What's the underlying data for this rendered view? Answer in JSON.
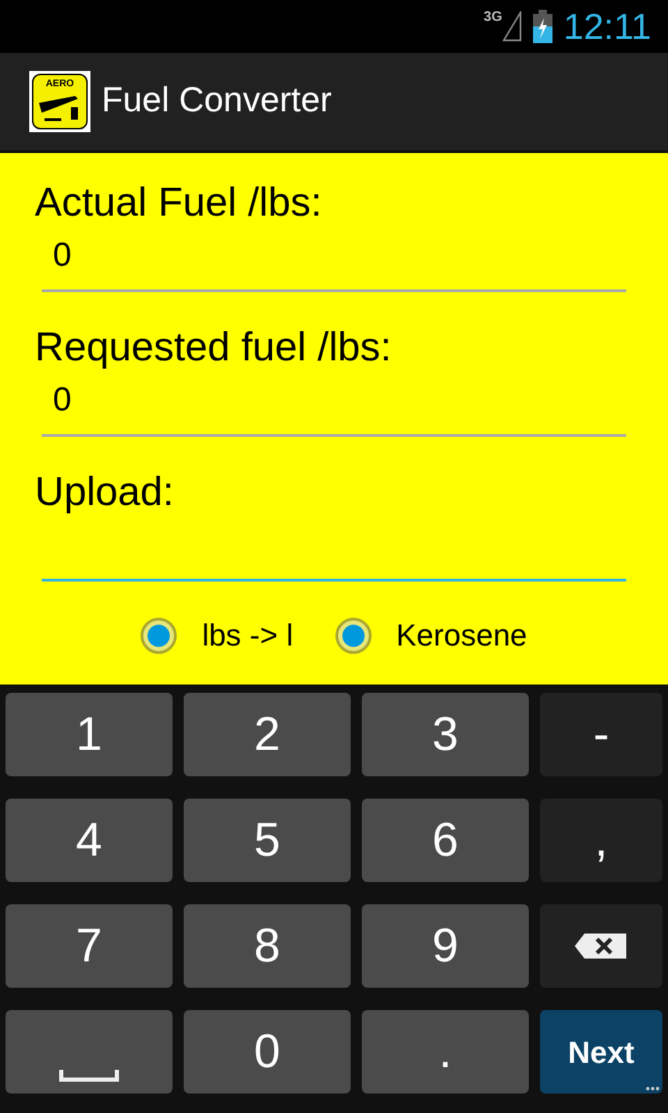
{
  "status_bar": {
    "network": "3G",
    "time": "12:11"
  },
  "action_bar": {
    "title": "Fuel Converter",
    "logo_text": "AERO"
  },
  "form": {
    "fields": [
      {
        "label": "Actual Fuel /lbs:",
        "value": "0",
        "focused": false
      },
      {
        "label": "Requested fuel /lbs:",
        "value": "0",
        "focused": false
      },
      {
        "label": "Upload:",
        "focused": true
      }
    ],
    "radios": [
      {
        "label": "lbs -> l",
        "selected": true
      },
      {
        "label": "Kerosene",
        "selected": true
      }
    ]
  },
  "keyboard": {
    "rows": [
      [
        {
          "kind": "light",
          "text": "1"
        },
        {
          "kind": "light",
          "text": "2"
        },
        {
          "kind": "light",
          "text": "3"
        },
        {
          "kind": "dark",
          "text": "-"
        }
      ],
      [
        {
          "kind": "light",
          "text": "4"
        },
        {
          "kind": "light",
          "text": "5"
        },
        {
          "kind": "light",
          "text": "6"
        },
        {
          "kind": "dark",
          "text": ","
        }
      ],
      [
        {
          "kind": "light",
          "text": "7"
        },
        {
          "kind": "light",
          "text": "8"
        },
        {
          "kind": "light",
          "text": "9"
        },
        {
          "kind": "backspace"
        }
      ],
      [
        {
          "kind": "space"
        },
        {
          "kind": "light",
          "text": "0"
        },
        {
          "kind": "light",
          "text": "."
        },
        {
          "kind": "next",
          "text": "Next"
        }
      ]
    ]
  }
}
